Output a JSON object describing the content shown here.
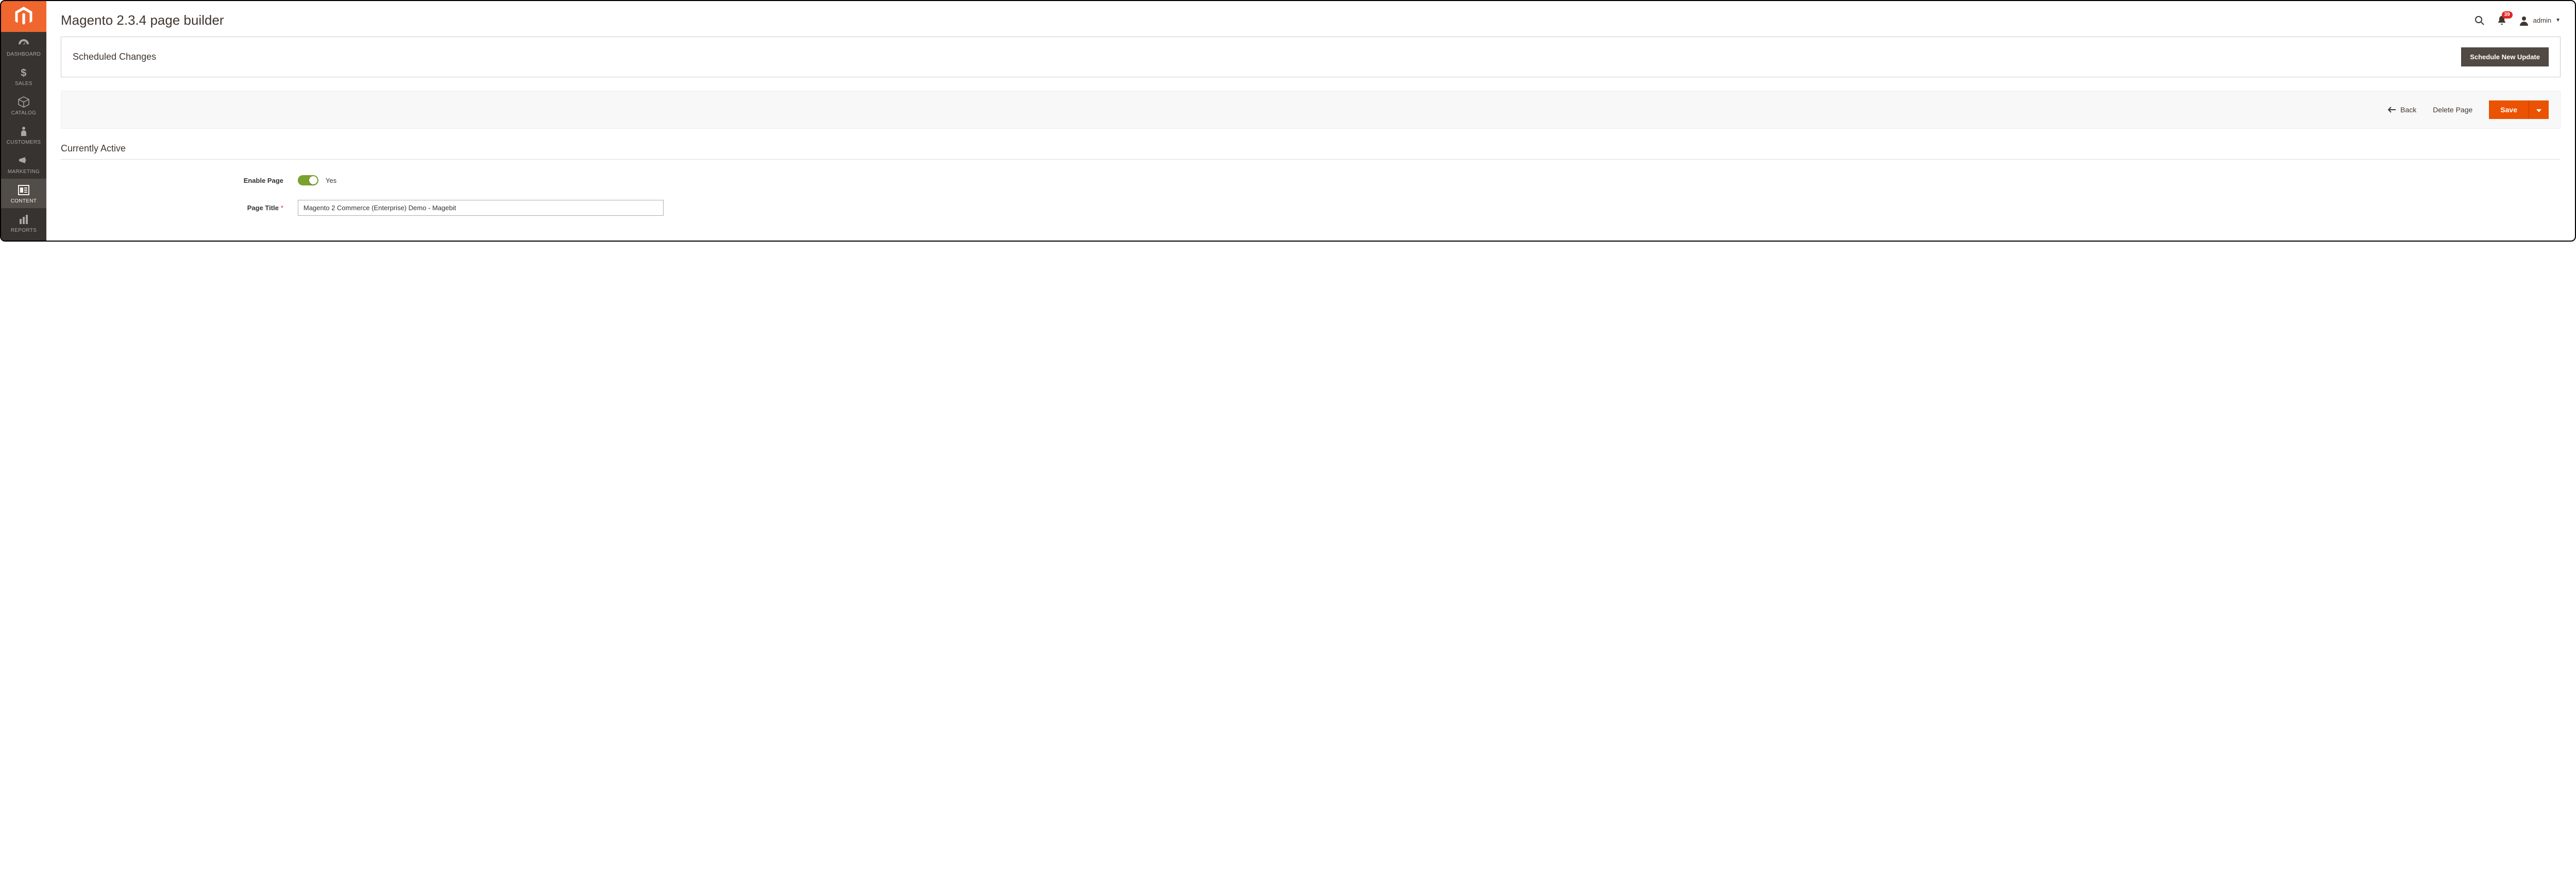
{
  "sidebar": {
    "items": [
      {
        "label": "DASHBOARD"
      },
      {
        "label": "SALES"
      },
      {
        "label": "CATALOG"
      },
      {
        "label": "CUSTOMERS"
      },
      {
        "label": "MARKETING"
      },
      {
        "label": "CONTENT"
      },
      {
        "label": "REPORTS"
      }
    ]
  },
  "header": {
    "title": "Magento 2.3.4 page builder",
    "notification_count": "39",
    "user_label": "admin"
  },
  "scheduled_panel": {
    "title": "Scheduled Changes",
    "button": "Schedule New Update"
  },
  "actions": {
    "back": "Back",
    "delete": "Delete Page",
    "save": "Save"
  },
  "section": {
    "title": "Currently Active"
  },
  "form": {
    "enable_label": "Enable Page",
    "enable_value_text": "Yes",
    "page_title_label": "Page Title",
    "page_title_value": "Magento 2 Commerce (Enterprise) Demo - Magebit"
  }
}
